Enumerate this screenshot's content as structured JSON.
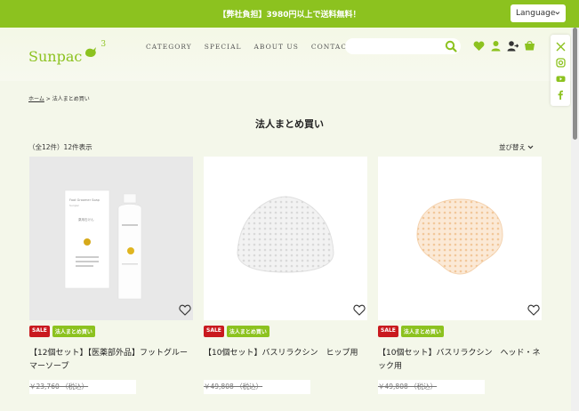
{
  "promo": {
    "text": "【弊社負担】3980円以上で送料無料！",
    "language": "Language"
  },
  "header": {
    "logo_text": "Sunpac",
    "logo_sup": "3",
    "nav": [
      "CATEGORY",
      "SPECIAL",
      "ABOUT US",
      "CONTACT"
    ],
    "search_placeholder": ""
  },
  "breadcrumb": {
    "home": "ホーム",
    "separator": ">",
    "current": "法人まとめ買い"
  },
  "page_title": "法人まとめ買い",
  "listing": {
    "count": "（全12件）12件表示",
    "sort": "並び替え"
  },
  "products": [
    {
      "tags": [
        "SALE",
        "法人まとめ買い"
      ],
      "name": "【12個セット】【医薬部外品】フットグルーマーソープ",
      "price": "￥23,760 （税込）"
    },
    {
      "tags": [
        "SALE",
        "法人まとめ買い"
      ],
      "name": "【10個セット】バスリラクシン　ヒップ用",
      "price": "￥49,808 （税込）"
    },
    {
      "tags": [
        "SALE",
        "法人まとめ買い"
      ],
      "name": "【10個セット】バスリラクシン　ヘッド・ネック用",
      "price": "￥49,808 （税込）"
    }
  ],
  "product_image_text": {
    "box_title": "Foot Groomer Soap",
    "box_sub": "Sunpac",
    "box_jp": "薬用石けん"
  },
  "colors": {
    "brand": "#8cc21f",
    "sale": "#c91a1f"
  }
}
